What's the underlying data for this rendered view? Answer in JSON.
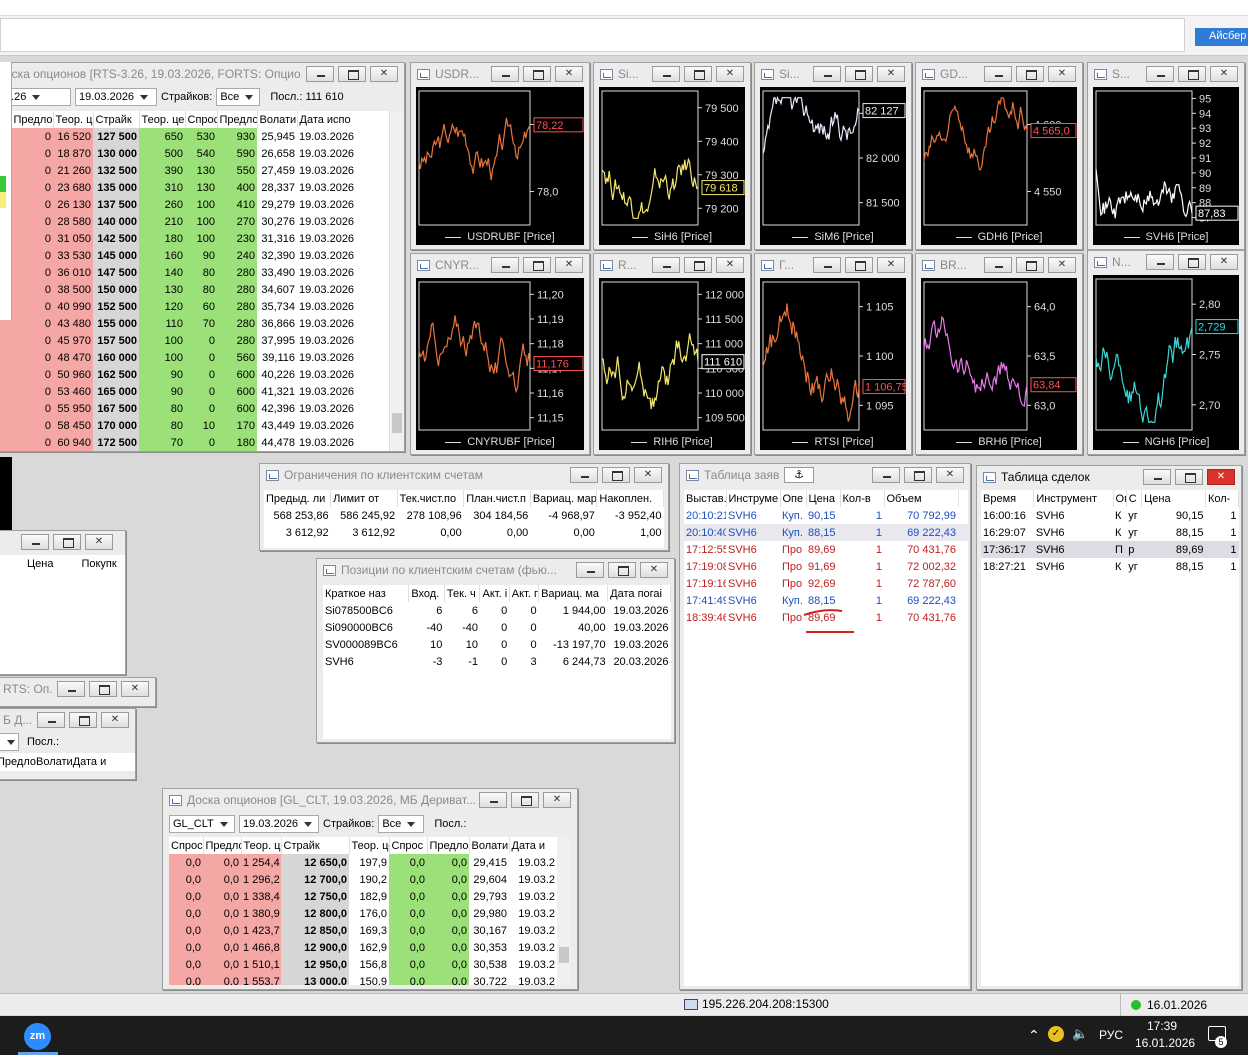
{
  "top": {
    "iceberg_label": "Айсбер"
  },
  "board1": {
    "title": "оска опционов [RTS-3.26, 19.03.2026, FORTS: Опцио...",
    "series_sel": "3.26",
    "date_sel": "19.03.2026",
    "strikes_label": "Страйков:",
    "strikes_sel": "Все",
    "last_label": "Посл.: 111 610",
    "headers": [
      "с",
      "Предло",
      "Теор. ц",
      "Страйк",
      "Теор. це",
      "Спрос",
      "Предло",
      "Волати",
      "Дата испо"
    ],
    "rows": [
      [
        "0",
        "16 520",
        "127 500",
        "650",
        "530",
        "930",
        "25,945",
        "19.03.2026"
      ],
      [
        "0",
        "18 870",
        "130 000",
        "500",
        "540",
        "590",
        "26,658",
        "19.03.2026"
      ],
      [
        "0",
        "21 260",
        "132 500",
        "390",
        "130",
        "550",
        "27,459",
        "19.03.2026"
      ],
      [
        "0",
        "23 680",
        "135 000",
        "310",
        "130",
        "400",
        "28,337",
        "19.03.2026"
      ],
      [
        "0",
        "26 130",
        "137 500",
        "260",
        "100",
        "410",
        "29,279",
        "19.03.2026"
      ],
      [
        "0",
        "28 580",
        "140 000",
        "210",
        "100",
        "270",
        "30,276",
        "19.03.2026"
      ],
      [
        "0",
        "31 050",
        "142 500",
        "180",
        "100",
        "230",
        "31,316",
        "19.03.2026"
      ],
      [
        "0",
        "33 530",
        "145 000",
        "160",
        "90",
        "240",
        "32,390",
        "19.03.2026"
      ],
      [
        "0",
        "36 010",
        "147 500",
        "140",
        "80",
        "280",
        "33,490",
        "19.03.2026"
      ],
      [
        "0",
        "38 500",
        "150 000",
        "130",
        "80",
        "280",
        "34,607",
        "19.03.2026"
      ],
      [
        "0",
        "40 990",
        "152 500",
        "120",
        "60",
        "280",
        "35,734",
        "19.03.2026"
      ],
      [
        "0",
        "43 480",
        "155 000",
        "110",
        "70",
        "280",
        "36,866",
        "19.03.2026"
      ],
      [
        "0",
        "45 970",
        "157 500",
        "100",
        "0",
        "280",
        "37,995",
        "19.03.2026"
      ],
      [
        "0",
        "48 470",
        "160 000",
        "100",
        "0",
        "560",
        "39,116",
        "19.03.2026"
      ],
      [
        "0",
        "50 960",
        "162 500",
        "90",
        "0",
        "600",
        "40,226",
        "19.03.2026"
      ],
      [
        "0",
        "53 460",
        "165 000",
        "90",
        "0",
        "600",
        "41,321",
        "19.03.2026"
      ],
      [
        "0",
        "55 950",
        "167 500",
        "80",
        "0",
        "600",
        "42,396",
        "19.03.2026"
      ],
      [
        "0",
        "58 450",
        "170 000",
        "80",
        "10",
        "170",
        "43,449",
        "19.03.2026"
      ],
      [
        "0",
        "60 940",
        "172 500",
        "70",
        "0",
        "180",
        "44,478",
        "19.03.2026"
      ]
    ]
  },
  "charts": [
    {
      "id": "usd",
      "title": "USDR...",
      "legend": "USDRUBF [Price]",
      "color": "#e8743b",
      "ticks": [
        "78,5",
        "78,0"
      ],
      "tag": "78,22",
      "tagColor": "#ff5050"
    },
    {
      "id": "si1",
      "title": "Si...",
      "legend": "SiH6 [Price]",
      "color": "#f5e66a",
      "ticks": [
        "79 500",
        "79 400",
        "79 300",
        "79 200"
      ],
      "tag": "79 618",
      "tagColor": "#f5e66a"
    },
    {
      "id": "si2",
      "title": "Si...",
      "legend": "SiM6 [Price]",
      "color": "#e8e8ff",
      "ticks": [
        "82 500",
        "82 000",
        "81 500"
      ],
      "tag": "82 127",
      "tagColor": "#e8e8ff"
    },
    {
      "id": "gd",
      "title": "GD...",
      "legend": "GDH6 [Price]",
      "color": "#e8743b",
      "ticks": [
        "4 600",
        "4 550"
      ],
      "tag": "4 565,0",
      "tagColor": "#ff5050"
    },
    {
      "id": "sv",
      "title": "S...",
      "legend": "SVH6 [Price]",
      "color": "#ffffff",
      "ticks": [
        "95",
        "94",
        "93",
        "92",
        "91",
        "90",
        "89",
        "88",
        "87"
      ],
      "tag": "87,83",
      "tagColor": "#ffffff"
    },
    {
      "id": "cny",
      "title": "CNYR...",
      "legend": "CNYRUBF [Price]",
      "color": "#e8743b",
      "ticks": [
        "11,20",
        "11,19",
        "11,18",
        "11,17",
        "11,16",
        "11,15"
      ],
      "tag": "11,176",
      "tagColor": "#ff5050"
    },
    {
      "id": "ri",
      "title": "R...",
      "legend": "RIH6 [Price]",
      "color": "#f5e66a",
      "ticks": [
        "112 000",
        "111 500",
        "111 000",
        "110 500",
        "110 000",
        "109 500"
      ],
      "tag": "111 610",
      "tagColor": "#ffffff"
    },
    {
      "id": "rts",
      "title": "Г...",
      "legend": "RTSI [Price]",
      "color": "#e8743b",
      "ticks": [
        "1 105",
        "1 100",
        "1 095"
      ],
      "tag": "1 106,75",
      "tagColor": "#ff5050"
    },
    {
      "id": "br",
      "title": "BR...",
      "legend": "BRH6 [Price]",
      "color": "#e87ae8",
      "ticks": [
        "64,0",
        "63,5",
        "63,0"
      ],
      "tag": "63,84",
      "tagColor": "#ff5050"
    },
    {
      "id": "ng",
      "title": "N...",
      "legend": "NGH6 [Price]",
      "color": "#3ad6d6",
      "ticks": [
        "2,80",
        "2,75",
        "2,70"
      ],
      "tag": "2,729",
      "tagColor": "#3ad6d6"
    }
  ],
  "limits": {
    "title": "Ограничения по клиентским счетам",
    "headers": [
      "Предыд. ли",
      "Лимит от",
      "Тек.чист.по",
      "План.чист.п",
      "Вариац. мар",
      "Накоплен."
    ],
    "rows": [
      [
        "568 253,86",
        "586 245,92",
        "278 108,96",
        "304 184,56",
        "-4 968,97",
        "-3 952,40"
      ],
      [
        "3 612,92",
        "3 612,92",
        "0,00",
        "0,00",
        "0,00",
        "1,00"
      ]
    ]
  },
  "positions": {
    "title": "Позиции по клиентским счетам (фью...",
    "headers": [
      "Краткое наз",
      "Вход.",
      "Тек. ч",
      "Акт. і",
      "Акт. г",
      "Вариац. ма",
      "Дата погаі"
    ],
    "rows": [
      [
        "Si078500BC6",
        "6",
        "6",
        "0",
        "0",
        "1 944,00",
        "19.03.2026"
      ],
      [
        "Si090000BC6",
        "-40",
        "-40",
        "0",
        "0",
        "40,00",
        "19.03.2026"
      ],
      [
        "SV000089BC6",
        "10",
        "10",
        "0",
        "0",
        "-13 197,70",
        "19.03.2026"
      ],
      [
        "SVH6",
        "-3",
        "-1",
        "0",
        "3",
        "6 244,73",
        "20.03.2026"
      ]
    ]
  },
  "orders": {
    "title": "Таблица заяв",
    "headers": [
      "Выстав.",
      "Инструме",
      "Опе",
      "Цена",
      "Кол-в",
      "Объем"
    ],
    "rows": [
      {
        "t": "20:10:21",
        "i": "SVH6",
        "o": "Куп.",
        "p": "90,15",
        "q": "1",
        "v": "70 792,99",
        "c": "blue"
      },
      {
        "t": "20:10:40",
        "i": "SVH6",
        "o": "Куп.",
        "p": "88,15",
        "q": "1",
        "v": "69 222,43",
        "c": "blue"
      },
      {
        "t": "17:12:55",
        "i": "SVH6",
        "o": "Про",
        "p": "89,69",
        "q": "1",
        "v": "70 431,76",
        "c": "redt"
      },
      {
        "t": "17:19:08",
        "i": "SVH6",
        "o": "Про",
        "p": "91,69",
        "q": "1",
        "v": "72 002,32",
        "c": "redt"
      },
      {
        "t": "17:19:16",
        "i": "SVH6",
        "o": "Про",
        "p": "92,69",
        "q": "1",
        "v": "72 787,60",
        "c": "redt"
      },
      {
        "t": "17:41:49",
        "i": "SVH6",
        "o": "Куп.",
        "p": "88,15",
        "q": "1",
        "v": "69 222,43",
        "c": "blue"
      },
      {
        "t": "18:39:46",
        "i": "SVH6",
        "o": "Про",
        "p": "89,69",
        "q": "1",
        "v": "70 431,76",
        "c": "redt"
      }
    ]
  },
  "trades": {
    "title": "Таблица сделок",
    "headers": [
      "Время",
      "Инструмент",
      "Оп",
      "С",
      "Цена",
      "Кол-"
    ],
    "rows": [
      [
        "16:00:16",
        "SVH6",
        "К",
        "уг",
        "90,15",
        "1"
      ],
      [
        "16:29:07",
        "SVH6",
        "К",
        "уг",
        "88,15",
        "1"
      ],
      [
        "17:36:17",
        "SVH6",
        "П",
        "р",
        "89,69",
        "1"
      ],
      [
        "18:27:21",
        "SVH6",
        "К",
        "уг",
        "88,15",
        "1"
      ]
    ]
  },
  "small1": {
    "col1": "Цена",
    "col2": "Покупк"
  },
  "small2": {
    "title": "RTS: Оп...",
    "title2": "Б Д...",
    "last": "Посл.:",
    "headers": [
      "Предло",
      "Волати",
      "Дата и"
    ]
  },
  "board2": {
    "title": "Доска опционов [GL_CLT, 19.03.2026, МБ Дериват...",
    "series_sel": "GL_CLT",
    "date_sel": "19.03.2026",
    "strikes_label": "Страйков:",
    "strikes_sel": "Все",
    "last_label": "Посл.:",
    "headers": [
      "Спрос",
      "Предло",
      "Теор. ц",
      "Страйк",
      "Теор. це",
      "Спрос",
      "Предло",
      "Волати",
      "Дата и"
    ],
    "rows": [
      [
        "0,0",
        "0,0",
        "1 254,4",
        "12 650,0",
        "197,9",
        "0,0",
        "0,0",
        "29,415",
        "19.03.2"
      ],
      [
        "0,0",
        "0,0",
        "1 296,2",
        "12 700,0",
        "190,2",
        "0,0",
        "0,0",
        "29,604",
        "19.03.2"
      ],
      [
        "0,0",
        "0,0",
        "1 338,4",
        "12 750,0",
        "182,9",
        "0,0",
        "0,0",
        "29,793",
        "19.03.2"
      ],
      [
        "0,0",
        "0,0",
        "1 380,9",
        "12 800,0",
        "176,0",
        "0,0",
        "0,0",
        "29,980",
        "19.03.2"
      ],
      [
        "0,0",
        "0,0",
        "1 423,7",
        "12 850,0",
        "169,3",
        "0,0",
        "0,0",
        "30,167",
        "19.03.2"
      ],
      [
        "0,0",
        "0,0",
        "1 466,8",
        "12 900,0",
        "162,9",
        "0,0",
        "0,0",
        "30,353",
        "19.03.2"
      ],
      [
        "0,0",
        "0,0",
        "1 510,1",
        "12 950,0",
        "156,8",
        "0,0",
        "0,0",
        "30,538",
        "19.03.2"
      ],
      [
        "0,0",
        "0,0",
        "1 553,7",
        "13 000,0",
        "150,9",
        "0,0",
        "0,0",
        "30,722",
        "19.03.2"
      ]
    ]
  },
  "status": {
    "server": "195.226.204.208:15300",
    "date": "16.01.2026"
  },
  "taskbar": {
    "app": "zm",
    "lang": "РУС",
    "time": "17:39",
    "date": "16.01.2026",
    "badge": "5"
  }
}
